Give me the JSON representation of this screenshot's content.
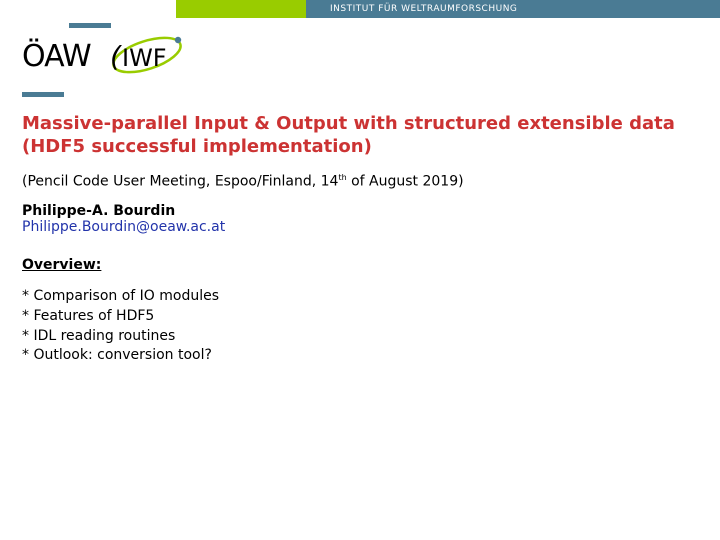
{
  "header": {
    "institute": "INSTITUT FÜR WELTRAUMFORSCHUNG"
  },
  "logo": {
    "oaw": "ÖAW",
    "iwf": "IWF"
  },
  "title": {
    "line1": "Massive-parallel Input & Output with structured extensible data",
    "line2": "(HDF5 successful implementation)"
  },
  "meeting": {
    "prefix": "(Pencil Code User Meeting, Espoo/Finland, 14",
    "sup": "th",
    "suffix": " of August 2019)"
  },
  "author": {
    "name": "Philippe-A. Bourdin",
    "email": "Philippe.Bourdin@oeaw.ac.at"
  },
  "overview": {
    "heading": "Overview:",
    "items": [
      "* Comparison of IO modules",
      "* Features of HDF5",
      "* IDL reading routines",
      "* Outlook: conversion tool?"
    ]
  }
}
